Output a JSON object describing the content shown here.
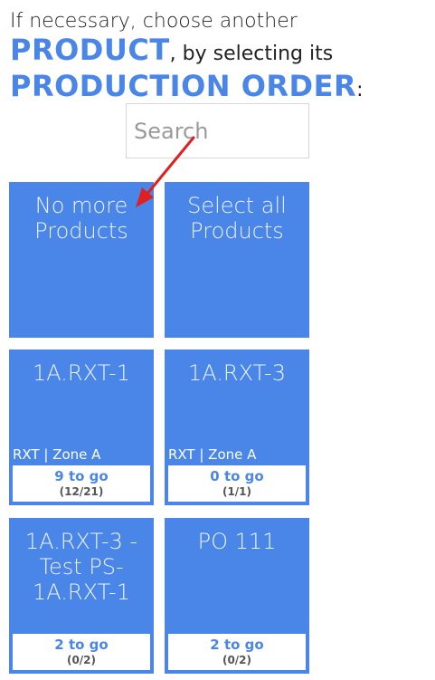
{
  "heading": {
    "line1": "If necessary, choose another",
    "product_word": "PRODUCT",
    "line2_rest": ", by selecting its",
    "production_order": "PRODUCTION ORDER",
    "colon": ":"
  },
  "search": {
    "placeholder": "Search",
    "value": ""
  },
  "special_tiles": [
    {
      "label": "No more Products"
    },
    {
      "label": "Select all Products"
    }
  ],
  "orders": [
    {
      "name": "1A.RXT-1",
      "location": "RXT | Zone A",
      "to_go": "9 to go",
      "count": "(12/21)"
    },
    {
      "name": "1A.RXT-3",
      "location": "RXT | Zone A",
      "to_go": "0 to go",
      "count": "(1/1)"
    },
    {
      "name": "1A.RXT-3 - Test PS-1A.RXT-1",
      "location": "",
      "to_go": "2 to go",
      "count": "(0/2)"
    },
    {
      "name": "PO 111",
      "location": "",
      "to_go": "2 to go",
      "count": "(0/2)"
    }
  ],
  "colors": {
    "tile": "#4a86e8",
    "accent": "#4a86e8",
    "arrow": "#e02020"
  }
}
